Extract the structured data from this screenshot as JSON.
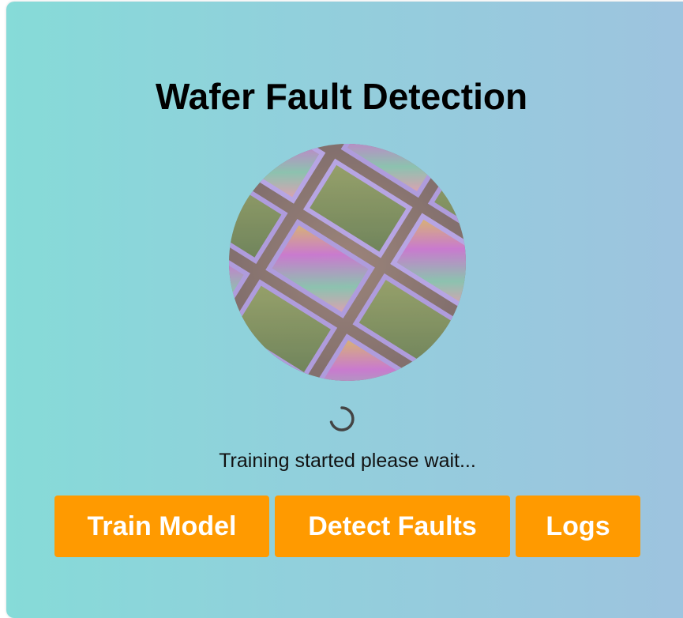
{
  "page": {
    "title": "Wafer Fault Detection",
    "status_text": "Training started please wait..."
  },
  "image": {
    "subject": "semiconductor wafer close-up"
  },
  "buttons": {
    "train_label": "Train Model",
    "detect_label": "Detect Faults",
    "logs_label": "Logs"
  },
  "colors": {
    "gradient_start": "#86dbd8",
    "gradient_end": "#9ec3df",
    "button_bg": "#ff9a00",
    "button_text": "#ffffff",
    "title_text": "#000000"
  },
  "icons": {
    "spinner": "loading-spinner-icon"
  }
}
